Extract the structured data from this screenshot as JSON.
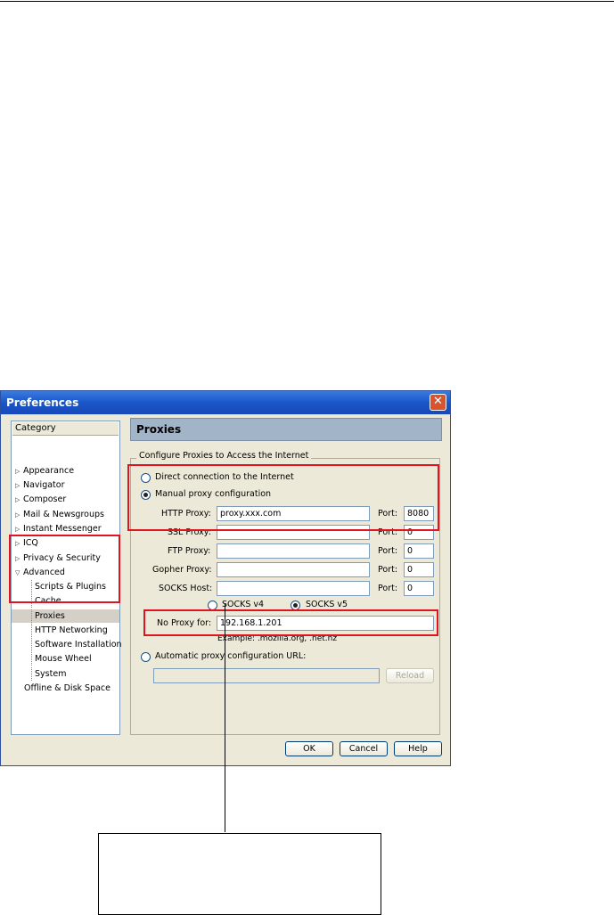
{
  "window": {
    "title": "Preferences",
    "close_glyph": "✕"
  },
  "category": {
    "header": "Category",
    "items": [
      {
        "label": "Appearance",
        "twisty": "▷"
      },
      {
        "label": "Navigator",
        "twisty": "▷"
      },
      {
        "label": "Composer",
        "twisty": "▷"
      },
      {
        "label": "Mail & Newsgroups",
        "twisty": "▷"
      },
      {
        "label": "Instant Messenger",
        "twisty": "▷"
      },
      {
        "label": "ICQ",
        "twisty": "▷"
      },
      {
        "label": "Privacy & Security",
        "twisty": "▷"
      },
      {
        "label": "Advanced",
        "twisty": "▽"
      },
      {
        "label": "Scripts & Plugins"
      },
      {
        "label": "Cache"
      },
      {
        "label": "Proxies"
      },
      {
        "label": "HTTP Networking"
      },
      {
        "label": "Software Installation"
      },
      {
        "label": "Mouse Wheel"
      },
      {
        "label": "System"
      },
      {
        "label": "Offline & Disk Space"
      }
    ]
  },
  "panel": {
    "title": "Proxies",
    "group_legend": "Configure Proxies to Access the Internet",
    "direct_label": "Direct connection to the Internet",
    "manual_label": "Manual proxy configuration",
    "http_label": "HTTP Proxy:",
    "http_value": "proxy.xxx.com",
    "http_port": "8080",
    "ssl_label": "SSL Proxy:",
    "ssl_value": "",
    "ssl_port": "0",
    "ftp_label": "FTP Proxy:",
    "ftp_value": "",
    "ftp_port": "0",
    "gopher_label": "Gopher Proxy:",
    "gopher_value": "",
    "gopher_port": "0",
    "socks_label": "SOCKS Host:",
    "socks_value": "",
    "socks_port": "0",
    "port_label": "Port:",
    "socks4_label": "SOCKS v4",
    "socks5_label": "SOCKS v5",
    "noproxy_label": "No Proxy for:",
    "noproxy_value": "192.168.1.201",
    "example": "Example: .mozilla.org, .net.nz",
    "auto_label": "Automatic proxy configuration URL:",
    "auto_value": "",
    "reload_label": "Reload"
  },
  "buttons": {
    "ok": "OK",
    "cancel": "Cancel",
    "help": "Help"
  },
  "colors": {
    "highlight": "#e0141e",
    "titlebar": "#1a56c9",
    "dialog_bg": "#ece9d8"
  }
}
